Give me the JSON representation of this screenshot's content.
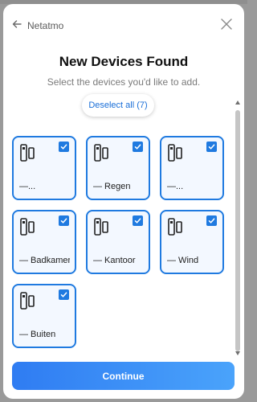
{
  "header": {
    "back_label": "Netatmo",
    "back_icon": "arrow-left-icon",
    "close_icon": "close-icon"
  },
  "title": "New Devices Found",
  "subtitle": "Select the devices you'd like to add.",
  "deselect_label": "Deselect all (7)",
  "devices": [
    {
      "label": "—...",
      "selected": true,
      "icon": "door-sensor-icon"
    },
    {
      "label": "— Regen",
      "selected": true,
      "icon": "door-sensor-icon"
    },
    {
      "label": "—...",
      "selected": true,
      "icon": "door-sensor-icon"
    },
    {
      "label": "— Badkamer",
      "selected": true,
      "icon": "door-sensor-icon"
    },
    {
      "label": "— Kantoor",
      "selected": true,
      "icon": "door-sensor-icon"
    },
    {
      "label": "— Wind",
      "selected": true,
      "icon": "door-sensor-icon"
    },
    {
      "label": "— Buiten",
      "selected": true,
      "icon": "door-sensor-icon"
    }
  ],
  "continue_label": "Continue",
  "colors": {
    "accent": "#1f7ae0",
    "card_bg": "#f3f8ff",
    "continue_start": "#2f7cf2",
    "continue_end": "#4aa3fb"
  }
}
